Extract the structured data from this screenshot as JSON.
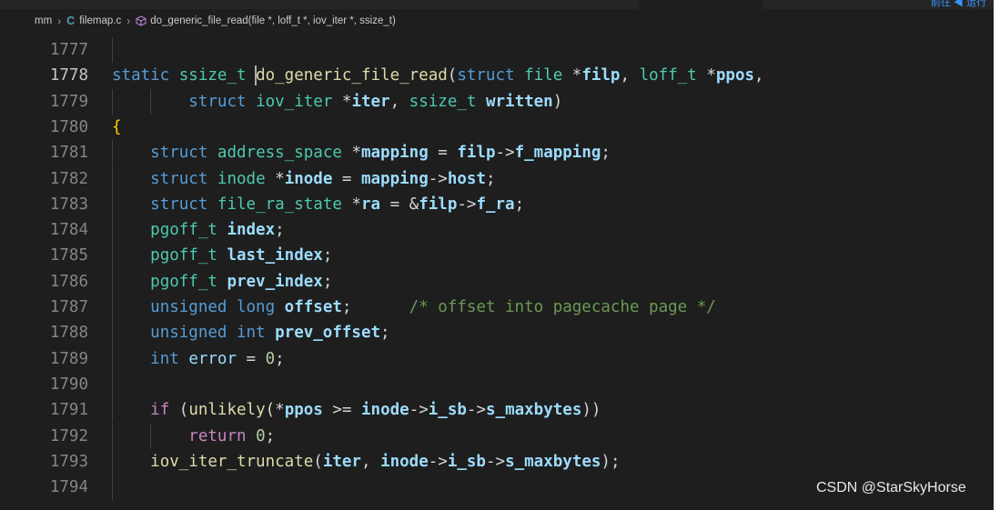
{
  "topbar": {
    "link": "前往 ◀ 运行"
  },
  "breadcrumb": {
    "folder": "mm",
    "file": "filemap.c",
    "symbol": "do_generic_file_read(file *, loff_t *, iov_iter *, ssize_t)"
  },
  "editor": {
    "active_line": "1778",
    "lines": [
      {
        "no": "1777",
        "tokens": []
      },
      {
        "no": "1778",
        "tokens": [
          {
            "t": "static ",
            "c": "kw"
          },
          {
            "t": "ssize_t ",
            "c": "ty"
          },
          {
            "t": "do_generic_file_read",
            "c": "fn"
          },
          {
            "t": "(",
            "c": "pun"
          },
          {
            "t": "struct ",
            "c": "kw"
          },
          {
            "t": "file ",
            "c": "ty"
          },
          {
            "t": "*",
            "c": "pun"
          },
          {
            "t": "filp",
            "c": "id"
          },
          {
            "t": ", ",
            "c": "pun"
          },
          {
            "t": "loff_t ",
            "c": "ty"
          },
          {
            "t": "*",
            "c": "pun"
          },
          {
            "t": "ppos",
            "c": "id"
          },
          {
            "t": ",",
            "c": "pun"
          }
        ]
      },
      {
        "no": "1779",
        "tokens": [
          {
            "t": "        ",
            "c": "pun"
          },
          {
            "t": "struct ",
            "c": "kw"
          },
          {
            "t": "iov_iter ",
            "c": "ty"
          },
          {
            "t": "*",
            "c": "pun"
          },
          {
            "t": "iter",
            "c": "id"
          },
          {
            "t": ", ",
            "c": "pun"
          },
          {
            "t": "ssize_t ",
            "c": "ty"
          },
          {
            "t": "written",
            "c": "id"
          },
          {
            "t": ")",
            "c": "pun"
          }
        ]
      },
      {
        "no": "1780",
        "tokens": [
          {
            "t": "{",
            "c": "brace"
          }
        ]
      },
      {
        "no": "1781",
        "tokens": [
          {
            "t": "    ",
            "c": "pun"
          },
          {
            "t": "struct ",
            "c": "kw"
          },
          {
            "t": "address_space ",
            "c": "ty"
          },
          {
            "t": "*",
            "c": "pun"
          },
          {
            "t": "mapping",
            "c": "id"
          },
          {
            "t": " = ",
            "c": "pun"
          },
          {
            "t": "filp",
            "c": "id"
          },
          {
            "t": "->",
            "c": "pun"
          },
          {
            "t": "f_mapping",
            "c": "id"
          },
          {
            "t": ";",
            "c": "pun"
          }
        ]
      },
      {
        "no": "1782",
        "tokens": [
          {
            "t": "    ",
            "c": "pun"
          },
          {
            "t": "struct ",
            "c": "kw"
          },
          {
            "t": "inode ",
            "c": "ty"
          },
          {
            "t": "*",
            "c": "pun"
          },
          {
            "t": "inode",
            "c": "id"
          },
          {
            "t": " = ",
            "c": "pun"
          },
          {
            "t": "mapping",
            "c": "id"
          },
          {
            "t": "->",
            "c": "pun"
          },
          {
            "t": "host",
            "c": "id"
          },
          {
            "t": ";",
            "c": "pun"
          }
        ]
      },
      {
        "no": "1783",
        "tokens": [
          {
            "t": "    ",
            "c": "pun"
          },
          {
            "t": "struct ",
            "c": "kw"
          },
          {
            "t": "file_ra_state ",
            "c": "ty"
          },
          {
            "t": "*",
            "c": "pun"
          },
          {
            "t": "ra",
            "c": "id"
          },
          {
            "t": " = &",
            "c": "pun"
          },
          {
            "t": "filp",
            "c": "id"
          },
          {
            "t": "->",
            "c": "pun"
          },
          {
            "t": "f_ra",
            "c": "id"
          },
          {
            "t": ";",
            "c": "pun"
          }
        ]
      },
      {
        "no": "1784",
        "tokens": [
          {
            "t": "    ",
            "c": "pun"
          },
          {
            "t": "pgoff_t ",
            "c": "ty"
          },
          {
            "t": "index",
            "c": "id"
          },
          {
            "t": ";",
            "c": "pun"
          }
        ]
      },
      {
        "no": "1785",
        "tokens": [
          {
            "t": "    ",
            "c": "pun"
          },
          {
            "t": "pgoff_t ",
            "c": "ty"
          },
          {
            "t": "last_index",
            "c": "id"
          },
          {
            "t": ";",
            "c": "pun"
          }
        ]
      },
      {
        "no": "1786",
        "tokens": [
          {
            "t": "    ",
            "c": "pun"
          },
          {
            "t": "pgoff_t ",
            "c": "ty"
          },
          {
            "t": "prev_index",
            "c": "id"
          },
          {
            "t": ";",
            "c": "pun"
          }
        ]
      },
      {
        "no": "1787",
        "tokens": [
          {
            "t": "    ",
            "c": "pun"
          },
          {
            "t": "unsigned long ",
            "c": "kw"
          },
          {
            "t": "offset",
            "c": "id"
          },
          {
            "t": ";",
            "c": "pun"
          },
          {
            "t": "      ",
            "c": "pun"
          },
          {
            "t": "/* offset into pagecache page */",
            "c": "cm"
          }
        ]
      },
      {
        "no": "1788",
        "tokens": [
          {
            "t": "    ",
            "c": "pun"
          },
          {
            "t": "unsigned int ",
            "c": "kw"
          },
          {
            "t": "prev_offset",
            "c": "id"
          },
          {
            "t": ";",
            "c": "pun"
          }
        ]
      },
      {
        "no": "1789",
        "tokens": [
          {
            "t": "    ",
            "c": "pun"
          },
          {
            "t": "int ",
            "c": "kw"
          },
          {
            "t": "error",
            "c": "var"
          },
          {
            "t": " = ",
            "c": "pun"
          },
          {
            "t": "0",
            "c": "num"
          },
          {
            "t": ";",
            "c": "pun"
          }
        ]
      },
      {
        "no": "1790",
        "tokens": []
      },
      {
        "no": "1791",
        "tokens": [
          {
            "t": "    ",
            "c": "pun"
          },
          {
            "t": "if ",
            "c": "ctl"
          },
          {
            "t": "(",
            "c": "pun"
          },
          {
            "t": "unlikely",
            "c": "fn"
          },
          {
            "t": "(*",
            "c": "pun"
          },
          {
            "t": "ppos",
            "c": "id"
          },
          {
            "t": " >= ",
            "c": "pun"
          },
          {
            "t": "inode",
            "c": "id"
          },
          {
            "t": "->",
            "c": "pun"
          },
          {
            "t": "i_sb",
            "c": "id"
          },
          {
            "t": "->",
            "c": "pun"
          },
          {
            "t": "s_maxbytes",
            "c": "id"
          },
          {
            "t": "))",
            "c": "pun"
          }
        ]
      },
      {
        "no": "1792",
        "tokens": [
          {
            "t": "        ",
            "c": "pun"
          },
          {
            "t": "return ",
            "c": "ctl"
          },
          {
            "t": "0",
            "c": "num"
          },
          {
            "t": ";",
            "c": "pun"
          }
        ]
      },
      {
        "no": "1793",
        "tokens": [
          {
            "t": "    ",
            "c": "pun"
          },
          {
            "t": "iov_iter_truncate",
            "c": "fn"
          },
          {
            "t": "(",
            "c": "pun"
          },
          {
            "t": "iter",
            "c": "id"
          },
          {
            "t": ", ",
            "c": "pun"
          },
          {
            "t": "inode",
            "c": "id"
          },
          {
            "t": "->",
            "c": "pun"
          },
          {
            "t": "i_sb",
            "c": "id"
          },
          {
            "t": "->",
            "c": "pun"
          },
          {
            "t": "s_maxbytes",
            "c": "id"
          },
          {
            "t": ");",
            "c": "pun"
          }
        ]
      },
      {
        "no": "1794",
        "tokens": []
      }
    ]
  },
  "watermark": "CSDN @StarSkyHorse"
}
